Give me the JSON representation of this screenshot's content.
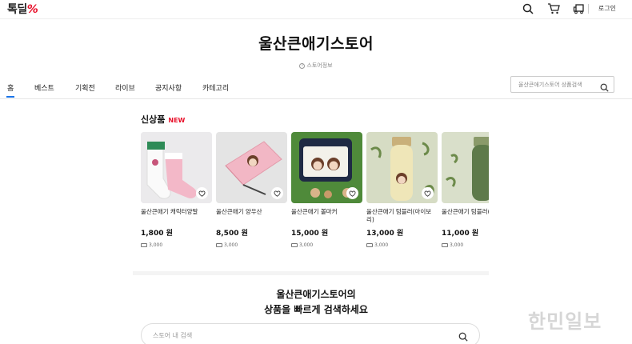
{
  "header": {
    "logo_text": "톡딜",
    "logo_mark": "%",
    "login_label": "로그인",
    "icons": [
      "search-icon",
      "cart-icon",
      "delivery-truck-icon"
    ]
  },
  "store": {
    "title": "울산큰애기스토어",
    "info_label": "스토어정보"
  },
  "nav": {
    "tabs": [
      {
        "label": "홈",
        "active": true
      },
      {
        "label": "베스트"
      },
      {
        "label": "기획전"
      },
      {
        "label": "라이브"
      },
      {
        "label": "공지사항"
      },
      {
        "label": "카테고리"
      }
    ],
    "search_placeholder": "울산큰애기스토어 상품검색"
  },
  "new_products": {
    "title": "신상품",
    "badge": "NEW",
    "items": [
      {
        "name": "울산큰애기 캐릭터양말",
        "price": "1,800 원",
        "shipping": "3,000"
      },
      {
        "name": "울산큰애기 양우산",
        "price": "8,500 원",
        "shipping": "3,000"
      },
      {
        "name": "울산큰애기 볼마커",
        "price": "15,000 원",
        "shipping": "3,000"
      },
      {
        "name": "울산큰애기 텀블러(아이보리)",
        "price": "13,000 원",
        "shipping": "3,000"
      },
      {
        "name": "울산큰애기 텀블러(그린)",
        "price": "11,000 원",
        "shipping": "3,000"
      }
    ]
  },
  "search_section": {
    "heading_line1": "울산큰애기스토어의",
    "heading_line2": "상품을 빠르게 검색하세요",
    "placeholder": "스토어 내 검색"
  },
  "watermark": "한민일보",
  "colors": {
    "accent": "#1a74e8",
    "brand_red": "#e8102a"
  }
}
